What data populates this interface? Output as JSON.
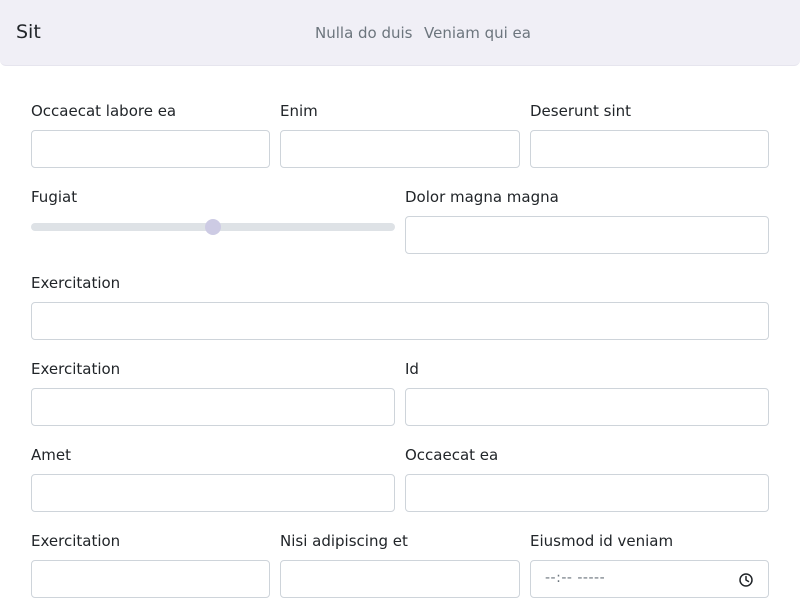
{
  "navbar": {
    "brand": "Sit",
    "links": [
      "Nulla do duis",
      "Veniam qui ea"
    ]
  },
  "form": {
    "row1": [
      "Occaecat labore ea",
      "Enim",
      "Deserunt sint"
    ],
    "row2": {
      "slider_label": "Fugiat",
      "slider_value_fraction": 0.5,
      "field_label": "Dolor magna magna"
    },
    "row3": [
      "Exercitation"
    ],
    "row4": [
      "Exercitation",
      "Id"
    ],
    "row5": [
      "Amet",
      "Occaecat ea"
    ],
    "row6": [
      "Exercitation",
      "Nisi adipiscing et",
      "Eiusmod id veniam"
    ],
    "time_placeholder": "--:-- -----"
  },
  "colors": {
    "navbar_bg": "#f0eff6",
    "slider_thumb": "#cdcbe4",
    "slider_track": "#dee2e6"
  }
}
